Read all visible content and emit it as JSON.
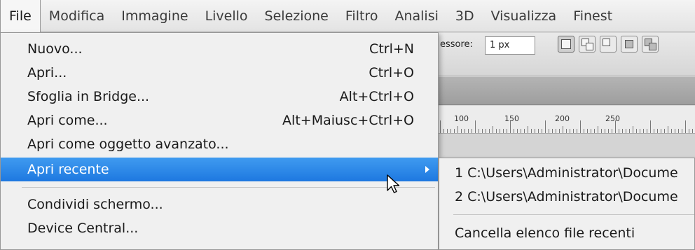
{
  "menubar": {
    "items": [
      "File",
      "Modifica",
      "Immagine",
      "Livello",
      "Selezione",
      "Filtro",
      "Analisi",
      "3D",
      "Visualizza",
      "Finest"
    ]
  },
  "options_bar": {
    "stroke_label": "essore:",
    "stroke_value": "1 px"
  },
  "ruler": {
    "labels": [
      "100",
      "150",
      "200",
      "250"
    ]
  },
  "file_menu": {
    "items": [
      {
        "label": "Nuovo...",
        "shortcut": "Ctrl+N"
      },
      {
        "label": "Apri...",
        "shortcut": "Ctrl+O"
      },
      {
        "label": "Sfoglia in Bridge...",
        "shortcut": "Alt+Ctrl+O"
      },
      {
        "label": "Apri come...",
        "shortcut": "Alt+Maiusc+Ctrl+O"
      },
      {
        "label": "Apri come oggetto avanzato...",
        "shortcut": ""
      },
      {
        "label": "Apri recente",
        "shortcut": ""
      },
      {
        "label": "Condividi schermo...",
        "shortcut": ""
      },
      {
        "label": "Device Central...",
        "shortcut": ""
      }
    ]
  },
  "recent_submenu": {
    "items": [
      "1 C:\\Users\\Administrator\\Docume",
      "2 C:\\Users\\Administrator\\Docume",
      "Cancella elenco file recenti"
    ]
  },
  "colors": {
    "highlight": "#1e78e0",
    "menu_bg": "#f0f0f0"
  },
  "icons": [
    "submenu-arrow-icon",
    "mouse-pointer-icon",
    "path-operation-icons"
  ]
}
